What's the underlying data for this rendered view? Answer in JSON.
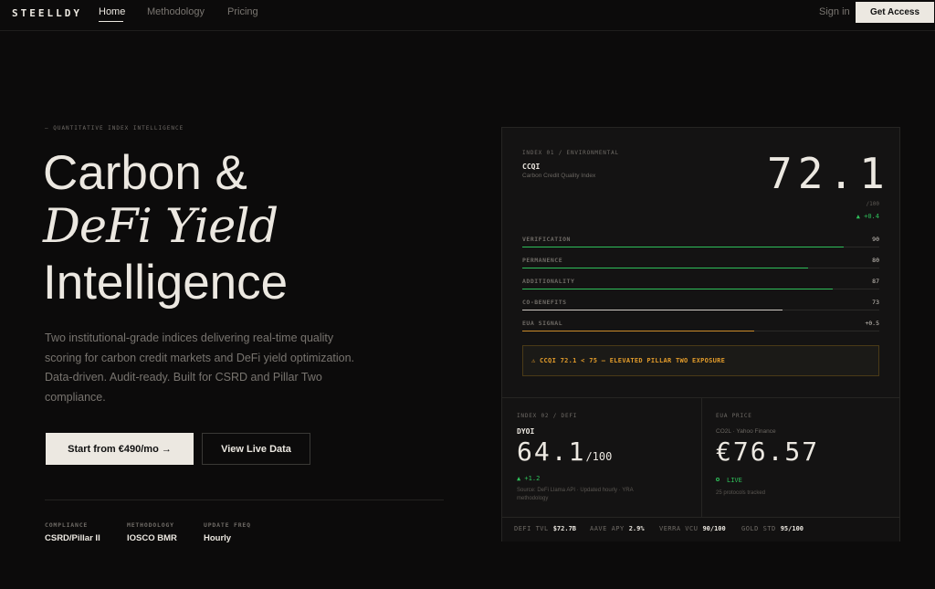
{
  "nav": {
    "logo": "STEELLDY",
    "links": [
      "Home",
      "Methodology",
      "Pricing"
    ],
    "sign_in": "Sign in",
    "cta": "Get Access"
  },
  "hero": {
    "eyebrow": "— QUANTITATIVE INDEX INTELLIGENCE",
    "title_line1": "Carbon &",
    "title_line2": "DeFi Yield",
    "title_line3": "Intelligence",
    "description": "Two institutional-grade indices delivering real-time quality scoring for carbon credit markets and DeFi yield optimization. Data-driven. Audit-ready. Built for CSRD and Pillar Two compliance.",
    "primary_button": "Start from €490/mo →",
    "secondary_button": "View Live Data",
    "meta": [
      {
        "label": "COMPLIANCE",
        "value": "CSRD/Pillar II"
      },
      {
        "label": "METHODOLOGY",
        "value": "IOSCO BMR"
      },
      {
        "label": "UPDATE FREQ",
        "value": "Hourly"
      }
    ]
  },
  "card": {
    "index1": {
      "label": "INDEX 01 / ENVIRONMENTAL",
      "code": "CCQI",
      "name": "Carbon Credit Quality Index",
      "score": "72.1",
      "scale": "/100",
      "delta": "▲ +0.4"
    },
    "pillars": [
      {
        "label": "VERIFICATION",
        "value": "90",
        "fill": 0.9,
        "color": "#2fbf5a"
      },
      {
        "label": "PERMANENCE",
        "value": "80",
        "fill": 0.8,
        "color": "#2fbf5a"
      },
      {
        "label": "ADDITIONALITY",
        "value": "87",
        "fill": 0.87,
        "color": "#2fbf5a"
      },
      {
        "label": "CO-BENEFITS",
        "value": "73",
        "fill": 0.73,
        "color": "#cfcac3"
      },
      {
        "label": "EUA SIGNAL",
        "value": "+0.5",
        "fill": 0.65,
        "color": "#c98a2a"
      }
    ],
    "alert": "⚠ CCQI 72.1 < 75 — ELEVATED PILLAR TWO EXPOSURE",
    "index2": {
      "label": "INDEX 02 / DEFI",
      "code": "DYOI",
      "score": "64.1",
      "scale": "/100",
      "delta": "▲ +1.2",
      "source": "Source: DeFi Llama API · Updated hourly · YRA methodology"
    },
    "eua": {
      "label": "EUA PRICE",
      "source": "CO2L · Yahoo Finance",
      "price": "€76.57",
      "status": "LIVE",
      "tracked": "25 protocols tracked"
    },
    "ticker": [
      {
        "label": "DEFI TVL",
        "value": "$72.7B"
      },
      {
        "label": "AAVE APY",
        "value": "2.9%"
      },
      {
        "label": "VERRA VCU",
        "value": "90/100"
      },
      {
        "label": "GOLD STD",
        "value": "95/100"
      }
    ]
  }
}
